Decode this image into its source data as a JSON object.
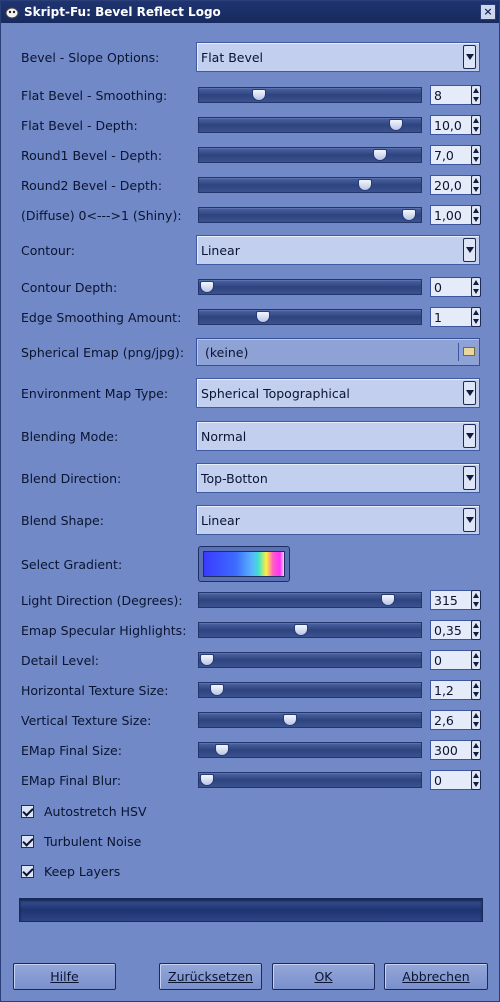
{
  "window": {
    "title": "Skript-Fu: Bevel Reflect Logo",
    "close_glyph": "×"
  },
  "fields": [
    {
      "label": "Bevel - Slope Options:",
      "value": "Flat Bevel"
    },
    {
      "label": "Flat Bevel - Smoothing:",
      "value": "8",
      "level": 0.25
    },
    {
      "label": "Flat Bevel - Depth:",
      "value": "10,0",
      "level": 0.91
    },
    {
      "label": "Round1 Bevel - Depth:",
      "value": "7,0",
      "level": 0.83
    },
    {
      "label": "Round2 Bevel - Depth:",
      "value": "20,0",
      "level": 0.76
    },
    {
      "label": "(Diffuse) 0<--->1 (Shiny):",
      "value": "1,00",
      "level": 0.97
    },
    {
      "label": "Contour:",
      "value": "Linear"
    },
    {
      "label": "Contour Depth:",
      "value": "0",
      "level": 0.0
    },
    {
      "label": "Edge Smoothing Amount:",
      "value": "1",
      "level": 0.27
    },
    {
      "label": "Spherical Emap (png/jpg):",
      "value": "(keine)"
    },
    {
      "label": "Environment Map Type:",
      "value": "Spherical Topographical"
    },
    {
      "label": "Blending Mode:",
      "value": "Normal"
    },
    {
      "label": "Blend Direction:",
      "value": "Top-Botton"
    },
    {
      "label": "Blend Shape:",
      "value": "Linear"
    },
    {
      "label": "Select Gradient:"
    },
    {
      "label": "Light Direction (Degrees):",
      "value": "315",
      "level": 0.87
    },
    {
      "label": "Emap Specular Highlights:",
      "value": "0,35",
      "level": 0.45
    },
    {
      "label": "Detail Level:",
      "value": "0",
      "level": 0.0
    },
    {
      "label": "Horizontal Texture Size:",
      "value": "1,2",
      "level": 0.05
    },
    {
      "label": "Vertical Texture Size:",
      "value": "2,6",
      "level": 0.4
    },
    {
      "label": "EMap Final Size:",
      "value": "300",
      "level": 0.07
    },
    {
      "label": "EMap Final Blur:",
      "value": "0",
      "level": 0.0
    }
  ],
  "checkboxes": [
    {
      "label": "Autostretch HSV",
      "checked": true
    },
    {
      "label": "Turbulent Noise",
      "checked": true
    },
    {
      "label": "Keep Layers",
      "checked": true
    }
  ],
  "buttons": {
    "help": "Hilfe",
    "reset": "Zurücksetzen",
    "ok": "OK",
    "cancel": "Abbrechen"
  },
  "colors": {
    "background": "#7189c6",
    "titlebar": "#1f3470",
    "accent": "#3f5aa0"
  }
}
